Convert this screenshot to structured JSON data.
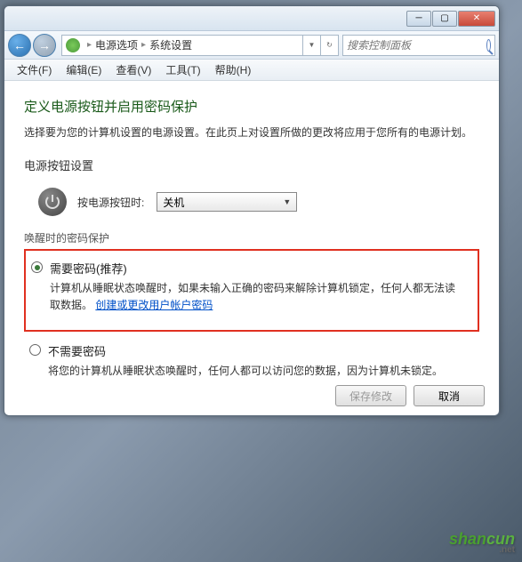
{
  "breadcrumb": {
    "item1": "电源选项",
    "item2": "系统设置"
  },
  "search": {
    "placeholder": "搜索控制面板"
  },
  "menu": {
    "file": "文件(F)",
    "edit": "编辑(E)",
    "view": "查看(V)",
    "tools": "工具(T)",
    "help": "帮助(H)"
  },
  "page": {
    "title": "定义电源按钮并启用密码保护",
    "desc": "选择要为您的计算机设置的电源设置。在此页上对设置所做的更改将应用于您所有的电源计划。"
  },
  "power_section": {
    "title": "电源按钮设置",
    "label": "按电源按钮时:",
    "value": "关机"
  },
  "wake_section": {
    "title": "唤醒时的密码保护",
    "opt1": {
      "label": "需要密码(推荐)",
      "desc1": "计算机从睡眠状态唤醒时，如果未输入正确的密码来解除计算机锁定，任何人都无法读取数据。",
      "link": "创建或更改用户帐户密码"
    },
    "opt2": {
      "label": "不需要密码",
      "desc": "将您的计算机从睡眠状态唤醒时，任何人都可以访问您的数据，因为计算机未锁定。"
    }
  },
  "footer": {
    "save": "保存修改",
    "cancel": "取消"
  },
  "watermark": {
    "text1": "shan",
    "text2": "cun",
    "text3": ".net"
  }
}
